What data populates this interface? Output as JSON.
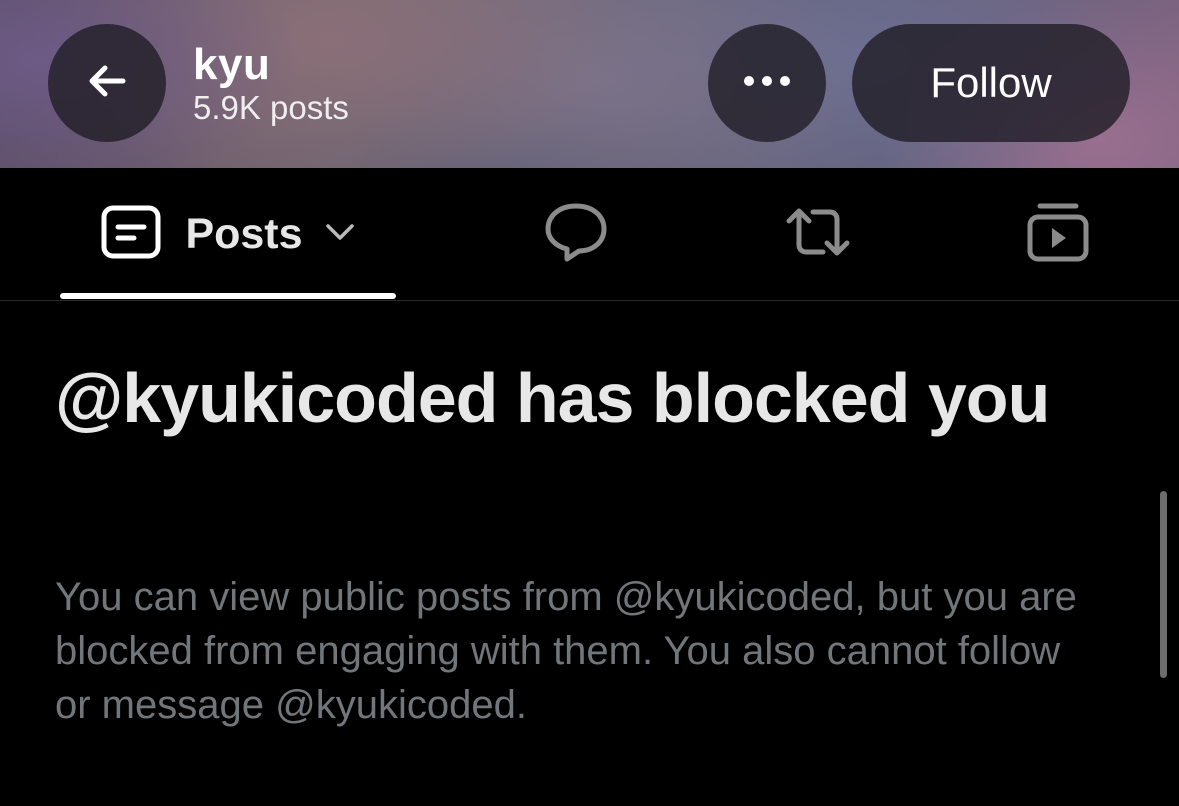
{
  "header": {
    "profile_name": "kyu",
    "post_count": "5.9K posts",
    "follow_label": "Follow",
    "back_icon": "arrow-left-icon",
    "more_icon": "more-horizontal-icon"
  },
  "tabs": {
    "posts_label": "Posts",
    "items": [
      {
        "id": "posts",
        "icon": "posts-icon",
        "active": true
      },
      {
        "id": "replies",
        "icon": "reply-bubble-icon",
        "active": false
      },
      {
        "id": "reposts",
        "icon": "repost-icon",
        "active": false
      },
      {
        "id": "media",
        "icon": "media-play-icon",
        "active": false
      }
    ]
  },
  "content": {
    "heading": "@kyukicoded has blocked you",
    "description": "You can view public posts from @kyukicoded, but you are blocked from engaging with them. You also cannot follow or message @kyukicoded."
  },
  "colors": {
    "background": "#000000",
    "text_primary": "#e7e7e7",
    "text_secondary": "#71767b",
    "button_bg": "#221e28"
  }
}
